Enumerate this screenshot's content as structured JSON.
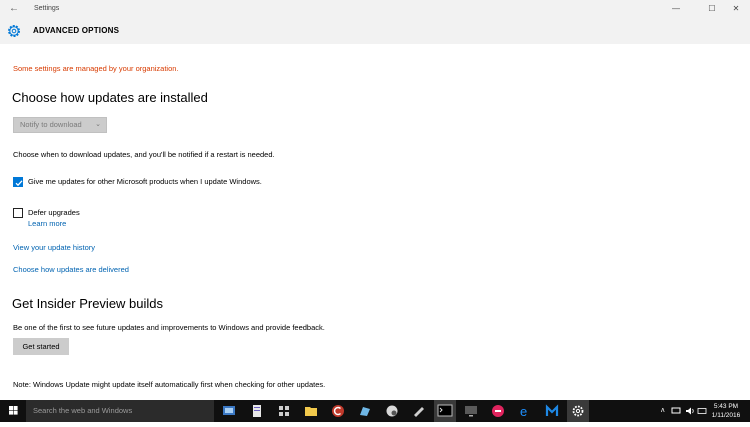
{
  "titlebar": {
    "title": "Settings",
    "back_glyph": "←",
    "minimize_glyph": "—",
    "maximize_glyph": "☐",
    "close_glyph": "✕"
  },
  "header": {
    "icon": "gear-icon",
    "title": "ADVANCED OPTIONS"
  },
  "content": {
    "org_notice": "Some settings are managed by your organization.",
    "install_heading": "Choose how updates are installed",
    "install_dropdown": {
      "selected": "Notify to download",
      "disabled": true
    },
    "download_info": "Choose when to download updates, and you'll be notified if a restart is needed.",
    "other_products": {
      "label": "Give me updates for other Microsoft products when I update Windows.",
      "checked": true
    },
    "defer_upgrades": {
      "label": "Defer upgrades",
      "checked": false
    },
    "learn_more": "Learn more",
    "history_link": "View your update history",
    "delivery_link": "Choose how updates are delivered",
    "insider_heading": "Get Insider Preview builds",
    "insider_info": "Be one of the first to see future updates and improvements to Windows and provide feedback.",
    "get_started": "Get started",
    "footer_note": "Note: Windows Update might update itself automatically first when checking for other updates."
  },
  "taskbar": {
    "search_placeholder": "Search the web and Windows",
    "time": "5:43 PM",
    "date": "1/11/2016",
    "tray_chevron": "ʌ"
  },
  "colors": {
    "accent": "#0078d7",
    "warning": "#d83b01",
    "link": "#0063b1",
    "taskbar": "#101010"
  }
}
